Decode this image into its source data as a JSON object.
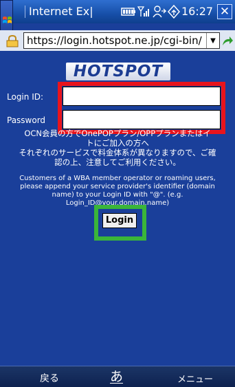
{
  "window": {
    "title": "Internet Ex|",
    "time": "16:27",
    "close_label": "✕"
  },
  "address_bar": {
    "url": "https://login.hotspot.ne.jp/cgi-bin/"
  },
  "page": {
    "logo_text": "HOTSPOT",
    "login_id_label": "Login ID:",
    "password_label": "Password",
    "login_id_value": "",
    "password_value": "",
    "jp_line1": "OCN会員の方でOnePOPプラン/OPPプランまたはイ",
    "jp_line2": "トにご加入の方へ",
    "jp_line3": "それぞれのサービスで料金体系が異なりますので、ご確",
    "jp_line4": "認の上、注意してご利用ください。",
    "en_line1": "Customers of a WBA member operator or roaming users,",
    "en_line2": "please append your service provider's identifier (domain",
    "en_line3": "name) to your Login ID with \"@\". (e.g.",
    "en_line4": "Login_ID@your.domain.name)",
    "login_button": "Login"
  },
  "softkeys": {
    "left": "戻る",
    "center": "あ",
    "right": "メニュー"
  },
  "highlights": {
    "credential_fields_color": "#e8141c",
    "login_button_color": "#3ab53a"
  },
  "icons": [
    "windows-flag-icon",
    "battery-icon",
    "signal-icon",
    "connectivity-icon",
    "sync-icon",
    "close-icon",
    "lock-icon",
    "dropdown-arrow-icon",
    "go-arrow-icon"
  ]
}
